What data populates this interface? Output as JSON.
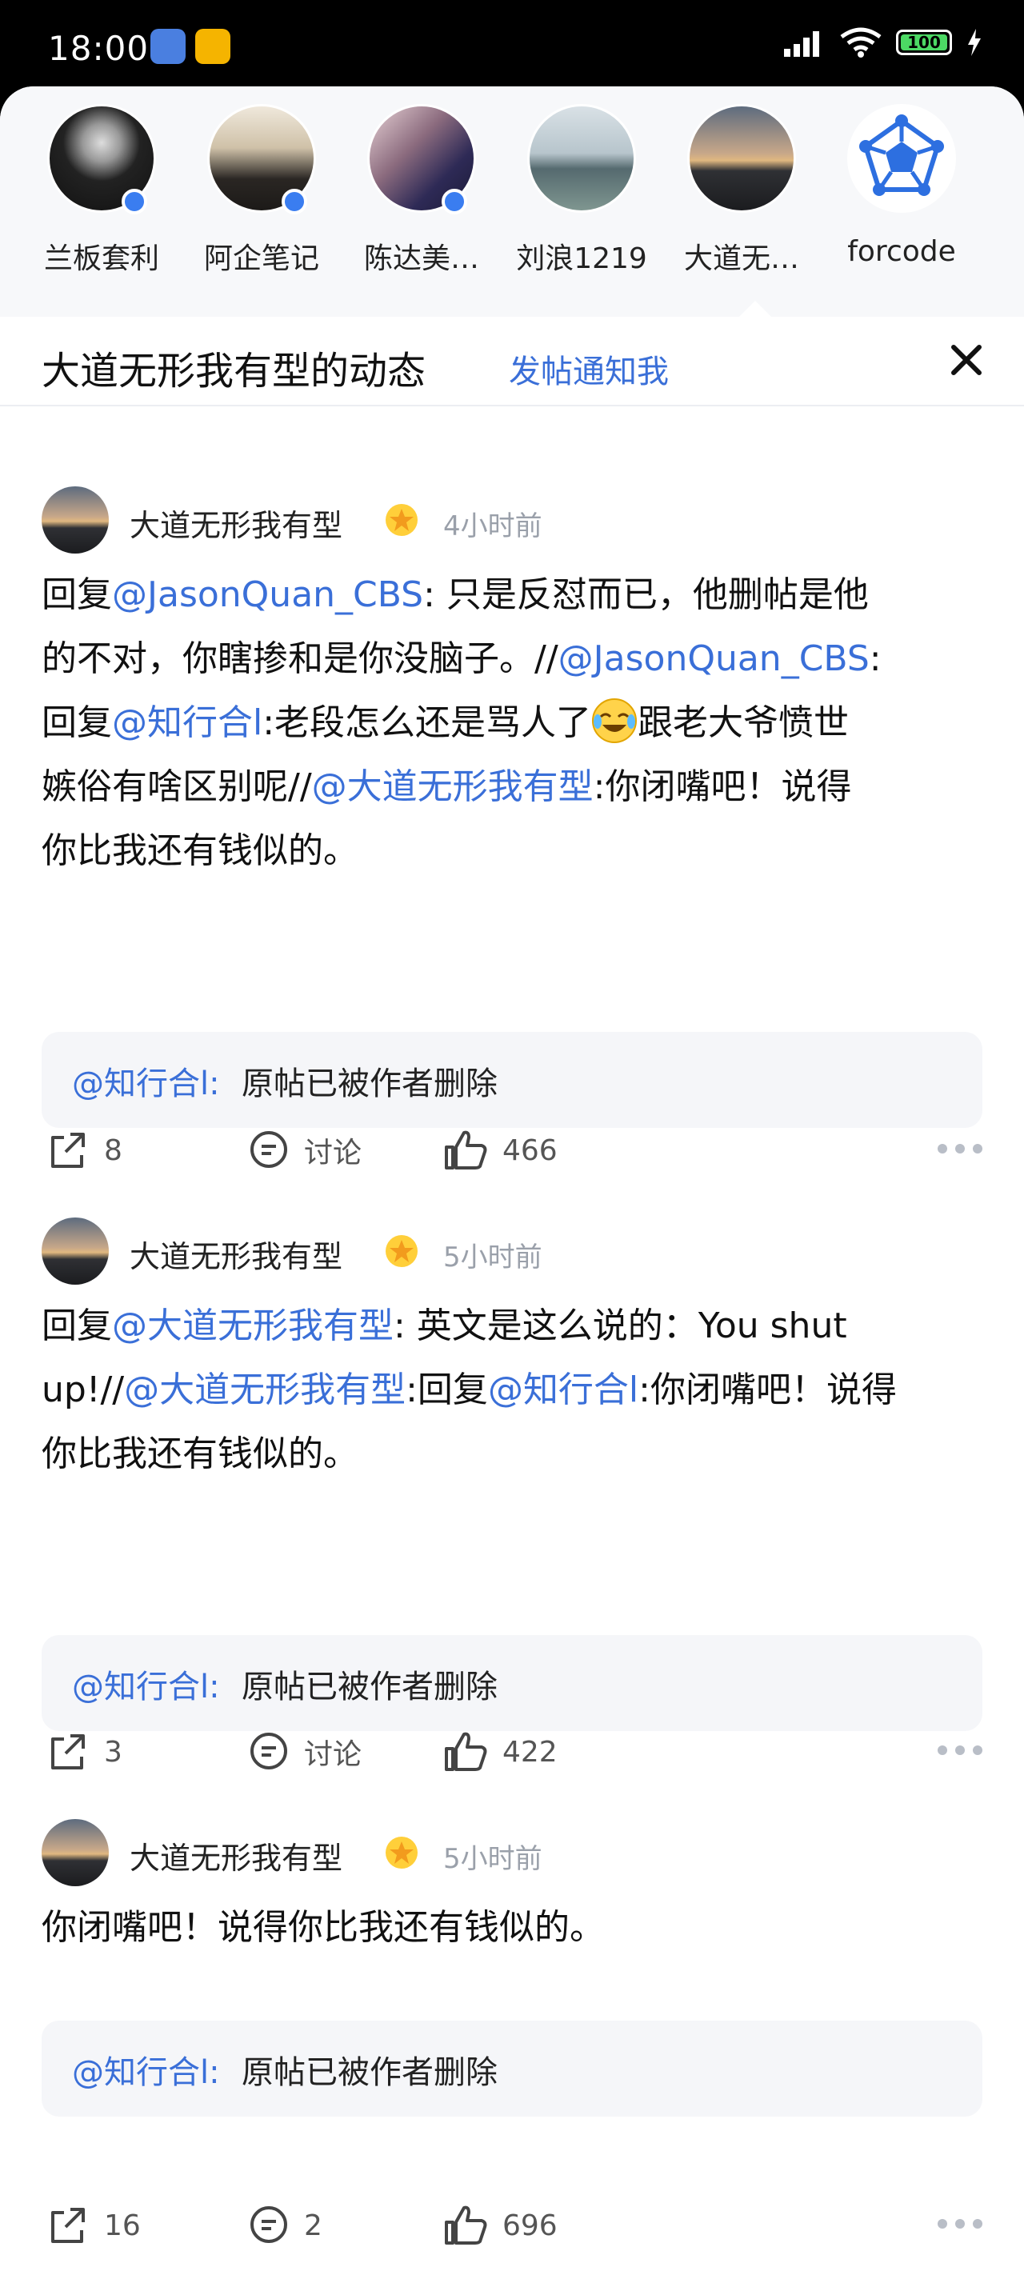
{
  "status_bar": {
    "time": "18:00",
    "battery": "100"
  },
  "friends": [
    {
      "name": "兰板套利",
      "online": true
    },
    {
      "name": "阿企笔记",
      "online": true
    },
    {
      "name": "陈达美…",
      "online": true
    },
    {
      "name": "刘浪1219",
      "online": false
    },
    {
      "name": "大道无…",
      "online": false
    },
    {
      "name": "forcode",
      "online": false
    }
  ],
  "header": {
    "title": "大道无形我有型的动态",
    "link": "发帖通知我"
  },
  "posts": [
    {
      "author": "大道无形我有型",
      "time": "4小时前",
      "body": {
        "p1": "回复",
        "m1": "@JasonQuan_CBS",
        "p2": ": 只是反怼而已，他删帖是他\n的不对，你瞎掺和是你没脑子。//",
        "m2": "@JasonQuan_CBS",
        "p3": ":\n回复",
        "m3": "@知行合l",
        "p4": ":老段怎么还是骂人了",
        "p5": "跟老大爷愤世\n嫉俗有啥区别呢//",
        "m4": "@大道无形我有型",
        "p6": ":你闭嘴吧！说得\n你比我还有钱似的。"
      },
      "quote": {
        "mention": "@知行合l:",
        "text": "原帖已被作者删除"
      },
      "actions": {
        "share": "8",
        "comment": "讨论",
        "like": "466"
      }
    },
    {
      "author": "大道无形我有型",
      "time": "5小时前",
      "body": {
        "p1": "回复",
        "m1": "@大道无形我有型",
        "p2": ": 英文是这么说的：You shut\nup!//",
        "m2": "@大道无形我有型",
        "p3": ":回复",
        "m3": "@知行合l",
        "p4": ":你闭嘴吧！说得\n你比我还有钱似的。"
      },
      "quote": {
        "mention": "@知行合l:",
        "text": "原帖已被作者删除"
      },
      "actions": {
        "share": "3",
        "comment": "讨论",
        "like": "422"
      }
    },
    {
      "author": "大道无形我有型",
      "time": "5小时前",
      "body": {
        "p1": "你闭嘴吧！说得你比我还有钱似的。"
      },
      "quote": {
        "mention": "@知行合l:",
        "text": "原帖已被作者删除"
      },
      "actions": {
        "share": "16",
        "comment": "2",
        "like": "696"
      }
    }
  ]
}
